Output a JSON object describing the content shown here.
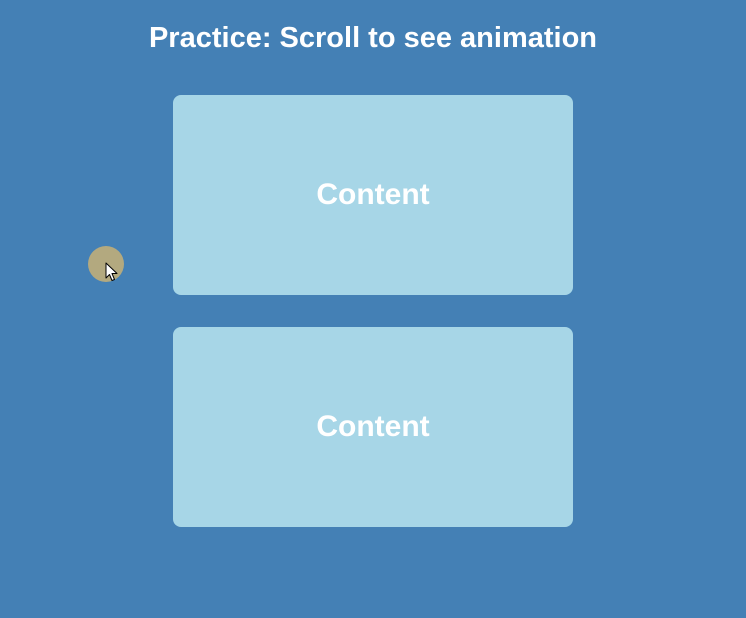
{
  "page": {
    "title": "Practice: Scroll to see animation",
    "background_color": "#4480b5"
  },
  "cards": [
    {
      "label": "Content",
      "color": "#a7d6e7"
    },
    {
      "label": "Content",
      "color": "#a7d6e7"
    }
  ],
  "cursor": {
    "icon": "cursor-arrow-icon",
    "highlight_color": "#b3a97f"
  }
}
